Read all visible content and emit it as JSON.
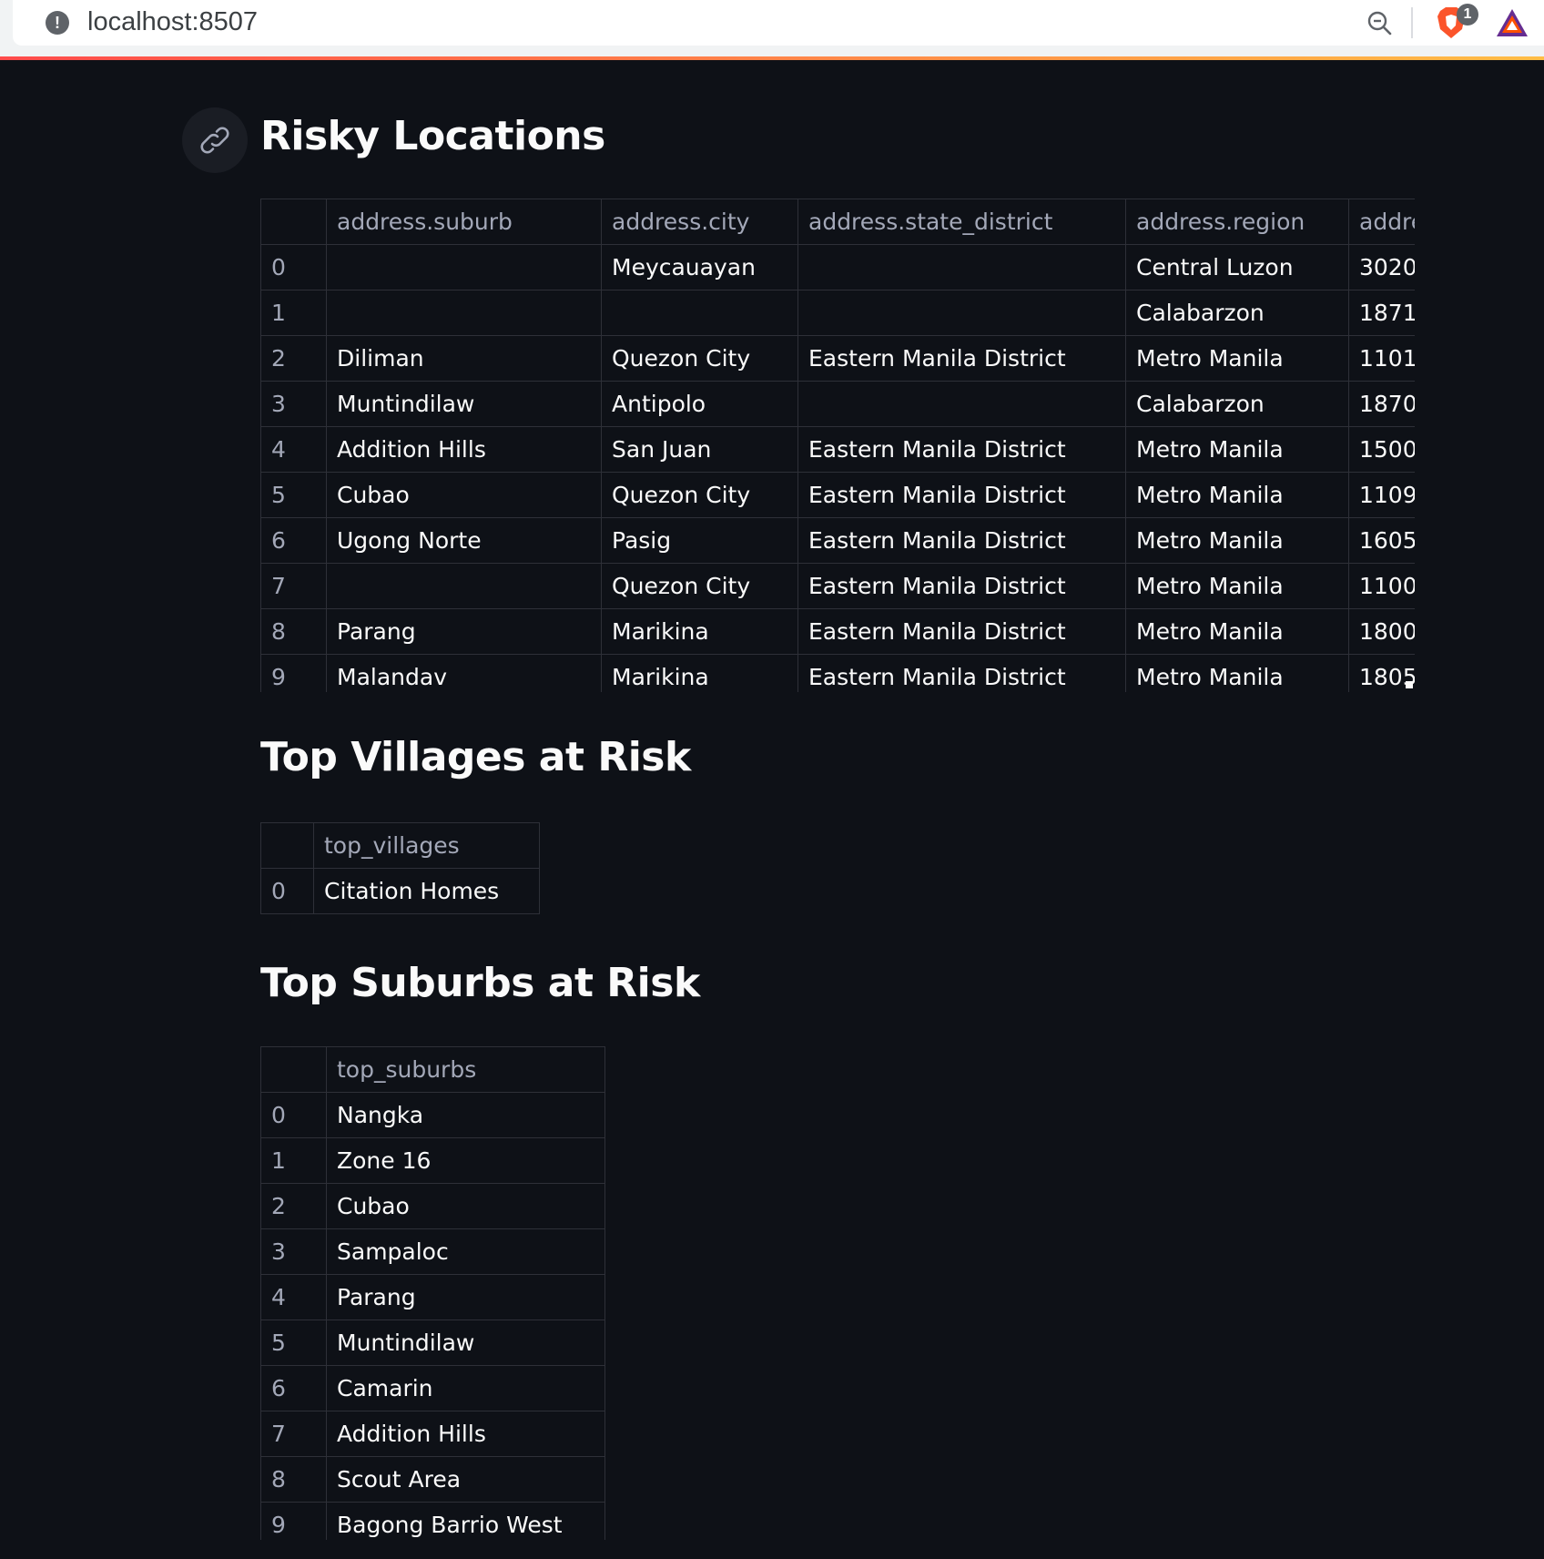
{
  "browser": {
    "url": "localhost:8507",
    "info_icon": "info-icon",
    "extension_badge": "1"
  },
  "risky": {
    "title": "Risky Locations",
    "columns": [
      "",
      "address.suburb",
      "address.city",
      "address.state_district",
      "address.region",
      "addre"
    ],
    "rows": [
      [
        "0",
        "",
        "Meycauayan",
        "",
        "Central Luzon",
        "3020"
      ],
      [
        "1",
        "",
        "",
        "",
        "Calabarzon",
        "1871"
      ],
      [
        "2",
        "Diliman",
        "Quezon City",
        "Eastern Manila District",
        "Metro Manila",
        "1101"
      ],
      [
        "3",
        "Muntindilaw",
        "Antipolo",
        "",
        "Calabarzon",
        "1870"
      ],
      [
        "4",
        "Addition Hills",
        "San Juan",
        "Eastern Manila District",
        "Metro Manila",
        "1500"
      ],
      [
        "5",
        "Cubao",
        "Quezon City",
        "Eastern Manila District",
        "Metro Manila",
        "1109"
      ],
      [
        "6",
        "Ugong Norte",
        "Pasig",
        "Eastern Manila District",
        "Metro Manila",
        "1605"
      ],
      [
        "7",
        "",
        "Quezon City",
        "Eastern Manila District",
        "Metro Manila",
        "1100"
      ],
      [
        "8",
        "Parang",
        "Marikina",
        "Eastern Manila District",
        "Metro Manila",
        "1800"
      ],
      [
        "9",
        "Malandav",
        "Marikina",
        "Eastern Manila District",
        "Metro Manila",
        "1805"
      ]
    ]
  },
  "villages": {
    "title": "Top Villages at Risk",
    "columns": [
      "",
      "top_villages"
    ],
    "rows": [
      [
        "0",
        "Citation Homes"
      ]
    ]
  },
  "suburbs": {
    "title": "Top Suburbs at Risk",
    "columns": [
      "",
      "top_suburbs"
    ],
    "rows": [
      [
        "0",
        "Nangka"
      ],
      [
        "1",
        "Zone 16"
      ],
      [
        "2",
        "Cubao"
      ],
      [
        "3",
        "Sampaloc"
      ],
      [
        "4",
        "Parang"
      ],
      [
        "5",
        "Muntindilaw"
      ],
      [
        "6",
        "Camarin"
      ],
      [
        "7",
        "Addition Hills"
      ],
      [
        "8",
        "Scout Area"
      ],
      [
        "9",
        "Bagong Barrio West"
      ]
    ]
  },
  "theme": {
    "background": "#0e1117",
    "text": "#fafafa",
    "muted_text": "#a3a8b8",
    "grid": "#2e3038"
  }
}
